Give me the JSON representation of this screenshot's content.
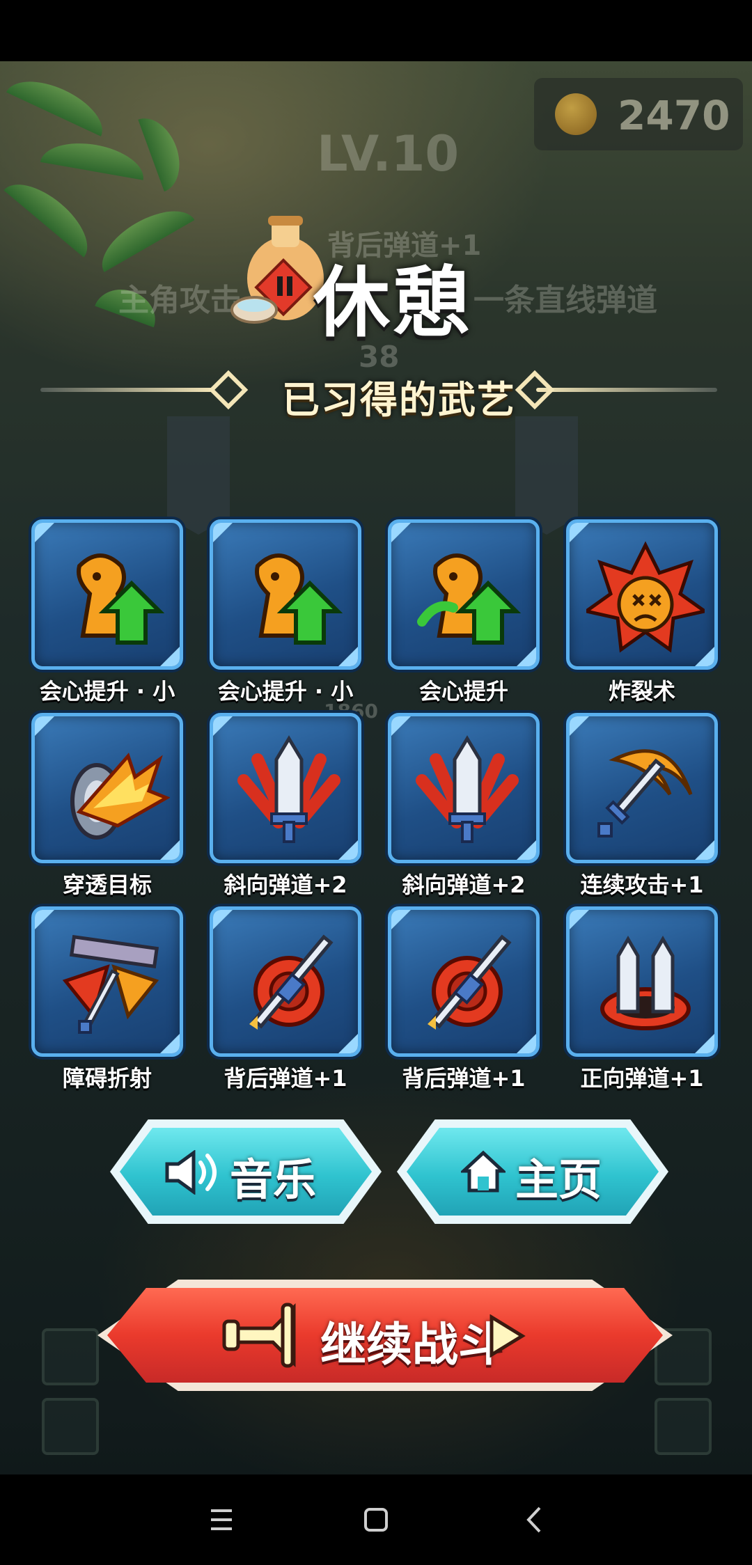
{
  "hud": {
    "coins": "2470",
    "level": "LV.10",
    "score": "38"
  },
  "background_text": {
    "line1": "背后弹道+1",
    "line2": "主角攻击",
    "line3": "一条直线弹道",
    "floor_marker": "1860"
  },
  "pause": {
    "title": "休憩"
  },
  "skills_section": {
    "title": "已习得的武艺",
    "skills": [
      {
        "label": "会心提升 · 小",
        "icon": "crit-up-small-icon"
      },
      {
        "label": "会心提升 · 小",
        "icon": "crit-up-small-icon"
      },
      {
        "label": "会心提升",
        "icon": "crit-up-icon"
      },
      {
        "label": "炸裂术",
        "icon": "explosion-icon"
      },
      {
        "label": "穿透目标",
        "icon": "pierce-icon"
      },
      {
        "label": "斜向弹道+2",
        "icon": "diagonal-shot-icon"
      },
      {
        "label": "斜向弹道+2",
        "icon": "diagonal-shot-icon"
      },
      {
        "label": "连续攻击+1",
        "icon": "combo-attack-icon"
      },
      {
        "label": "障碍折射",
        "icon": "wall-bounce-icon"
      },
      {
        "label": "背后弹道+1",
        "icon": "rear-shot-icon"
      },
      {
        "label": "背后弹道+1",
        "icon": "rear-shot-icon"
      },
      {
        "label": "正向弹道+1",
        "icon": "front-shot-icon"
      }
    ]
  },
  "buttons": {
    "music": "音乐",
    "home": "主页",
    "continue": "继续战斗"
  },
  "colors": {
    "tile_blue": "#2a5f9a",
    "button_cyan": "#2fc3cf",
    "button_red": "#ea3a2c"
  }
}
